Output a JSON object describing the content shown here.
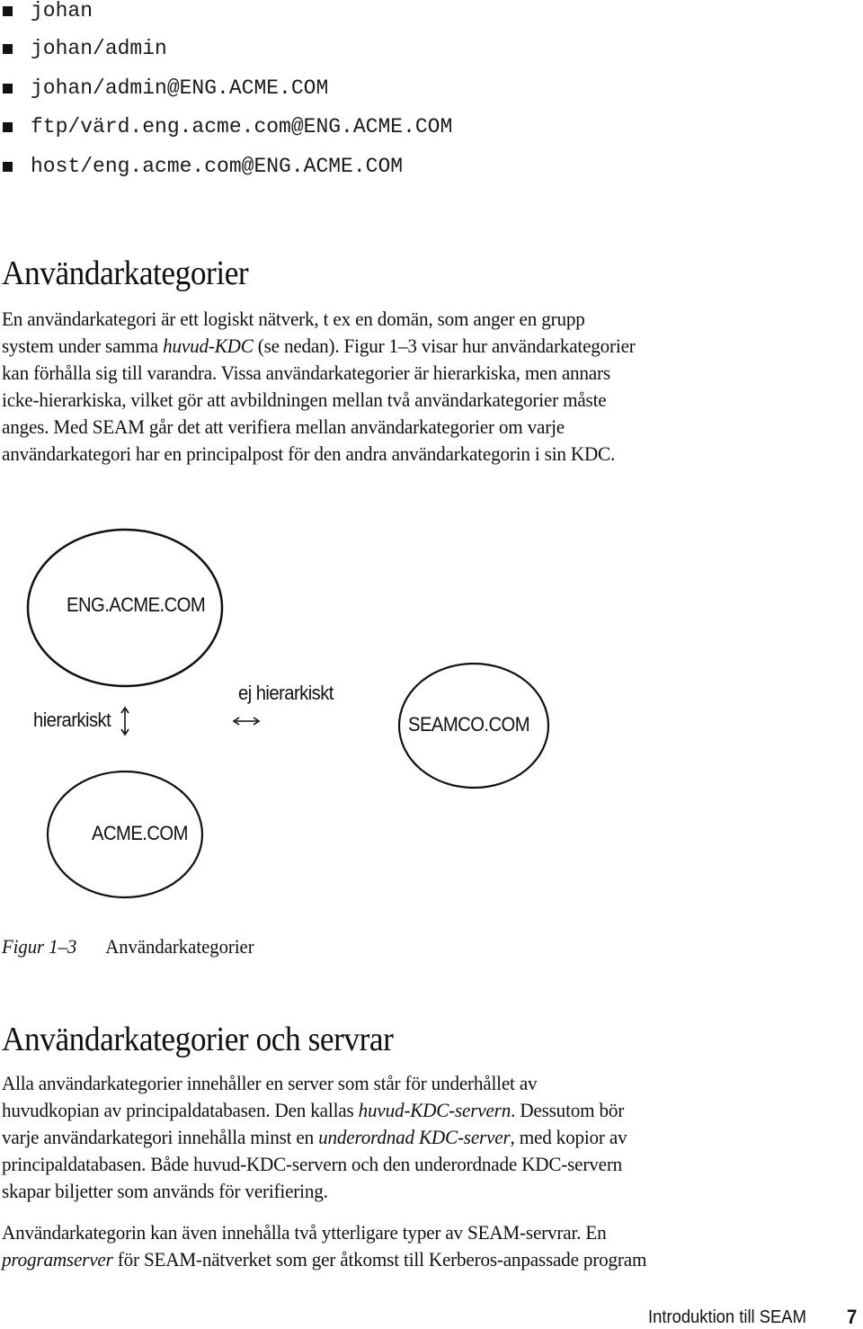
{
  "principal_examples": [
    "johan",
    "johan/admin",
    "johan/admin@ENG.ACME.COM",
    "ftp/värd.eng.acme.com@ENG.ACME.COM",
    "host/eng.acme.com@ENG.ACME.COM"
  ],
  "section1": {
    "heading": "Användarkategorier",
    "lines": [
      [
        "En användarkategori är ett logiskt nätverk, t ex en domän, som anger en grupp"
      ],
      [
        "system under samma ",
        {
          "i": "huvud-KDC"
        },
        " (se nedan). Figur 1–3 visar hur användarkategorier"
      ],
      [
        "kan förhålla sig till varandra. Vissa användarkategorier är hierarkiska, men annars"
      ],
      [
        "icke-hierarkiska, vilket gör att avbildningen mellan två användarkategorier måste"
      ],
      [
        "anges. Med SEAM går det att verifiera mellan användarkategorier om varje"
      ],
      [
        "användarkategori har en principalpost för den andra användarkategorin i sin KDC."
      ]
    ]
  },
  "diagram": {
    "nodes": [
      "ENG.ACME.COM",
      "SEAMCO.COM",
      "ACME.COM"
    ],
    "labels": {
      "hierarchical": "hierarkiskt",
      "non_hierarchical": "ej hierarkiskt"
    },
    "icons": {
      "vertical_arrow": "up-down-arrow-icon",
      "horizontal_arrow": "left-right-arrow-icon"
    }
  },
  "figure_caption": {
    "number": "Figur 1–3",
    "title": "Användarkategorier"
  },
  "section2": {
    "heading": "Användarkategorier och servrar",
    "paragraph1": [
      [
        "Alla användarkategorier innehåller en server som står för underhållet av"
      ],
      [
        "huvudkopian av principaldatabasen. Den kallas ",
        {
          "i": "huvud-KDC-servern"
        },
        ". Dessutom bör"
      ],
      [
        "varje användarkategori innehålla minst en ",
        {
          "i": "underordnad KDC-server"
        },
        ", med kopior av"
      ],
      [
        "principaldatabasen. Både huvud-KDC-servern och den underordnade KDC-servern"
      ],
      [
        "skapar biljetter som används för verifiering."
      ]
    ],
    "paragraph2": [
      [
        "Användarkategorin kan även innehålla två ytterligare typer av SEAM-servrar. En"
      ],
      [
        {
          "i": "programserver"
        },
        " för SEAM-nätverket som ger åtkomst till Kerberos-anpassade program"
      ]
    ]
  },
  "footer": {
    "title": "Introduktion till SEAM",
    "page_number": "7"
  }
}
